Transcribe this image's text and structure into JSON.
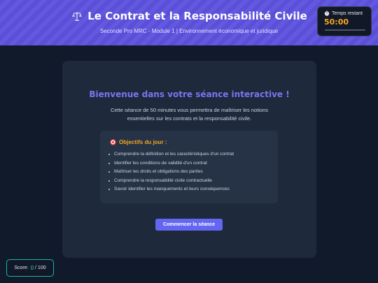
{
  "header": {
    "title": "Le Contrat et la Responsabilité Civile",
    "title_icon": "scales-icon",
    "subtitle": "Seconde Pro MRC - Module 1 | Environnement économique et juridique"
  },
  "timer": {
    "label": "Temps restant",
    "value": "50:00",
    "progress": 1.0,
    "icon": "stopwatch-icon"
  },
  "card": {
    "welcome": "Bienvenue dans votre séance interactive !",
    "intro": "Cette séance de 50 minutes vous permettra de maîtriser les notions essentielles sur les contrats et la responsabilité civile.",
    "objectives": {
      "icon": "target-icon",
      "title": "Objectifs du jour :",
      "items": [
        "Comprendre la définition et les caractéristiques d'un contrat",
        "Identifier les conditions de validité d'un contrat",
        "Maîtriser les droits et obligations des parties",
        "Comprendre la responsabilité civile contractuelle",
        "Savoir identifier les manquements et leurs conséquences"
      ]
    },
    "start_label": "Commencer la séance"
  },
  "score": {
    "label": "Score:",
    "value": "0",
    "total": "/ 100"
  },
  "colors": {
    "accent": "#6366f1",
    "timer_value": "#f5a623",
    "score_value": "#2dd4bf"
  }
}
